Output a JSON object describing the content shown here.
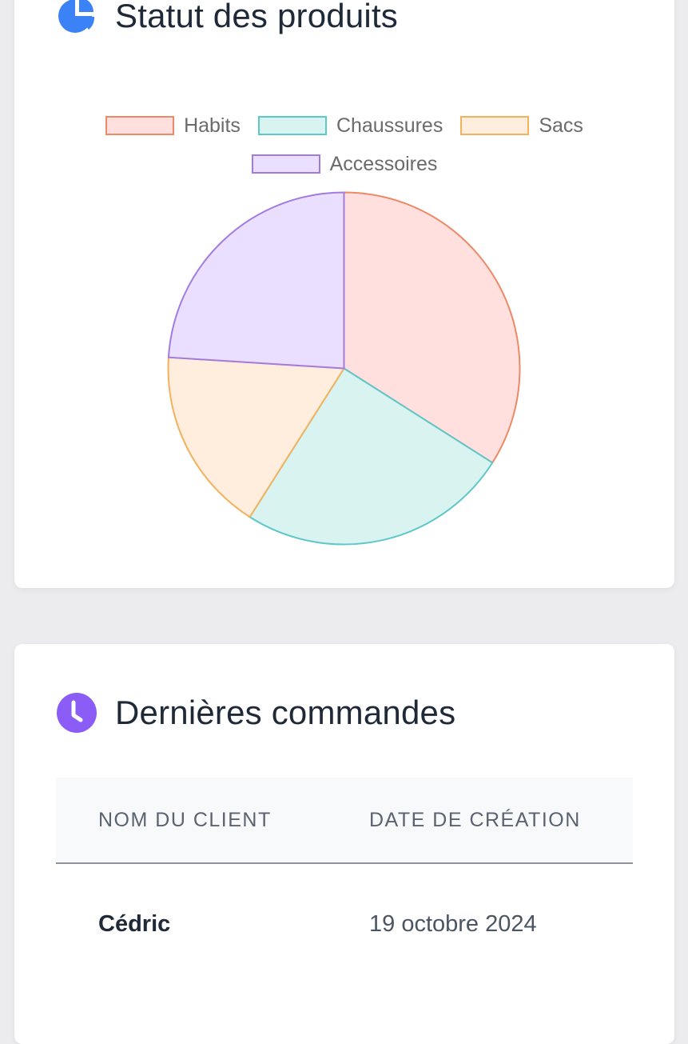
{
  "product_status": {
    "title": "Statut des produits",
    "icon": "chart-pie-icon",
    "icon_color": "#3b82f6"
  },
  "chart_data": {
    "type": "pie",
    "categories": [
      "Habits",
      "Chaussures",
      "Sacs",
      "Accessoires"
    ],
    "values": [
      34,
      25,
      17,
      24
    ],
    "fill_colors": [
      "#ffe0de",
      "#d9f3f1",
      "#ffeedd",
      "#ebdfff"
    ],
    "border_colors": [
      "#ec8a67",
      "#5ec7c7",
      "#f2b25e",
      "#a37be0"
    ],
    "legend_position": "top"
  },
  "recent_orders": {
    "title": "Dernières commandes",
    "icon": "clock-icon",
    "icon_color": "#8b5cf6",
    "columns": [
      "NOM DU CLIENT",
      "DATE DE CRÉATION"
    ],
    "rows": [
      {
        "client": "Cédric",
        "date": "19 octobre 2024"
      }
    ]
  }
}
